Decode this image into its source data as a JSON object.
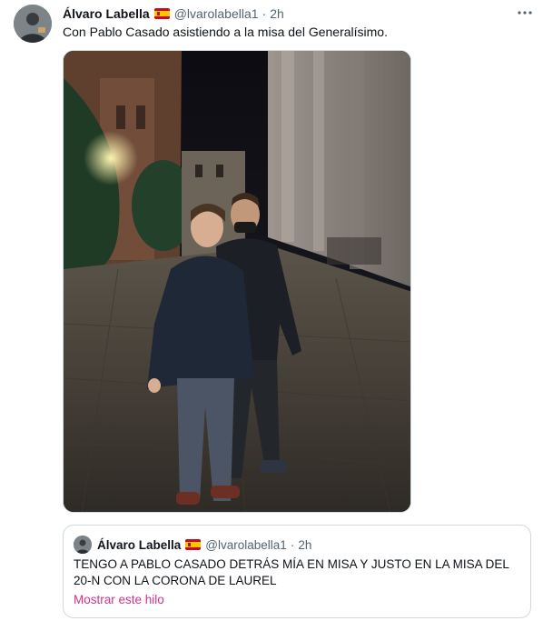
{
  "tweet": {
    "author_name": "Álvaro Labella",
    "flag_icon": "spain-flag-icon",
    "handle": "@lvarolabella1",
    "separator": "·",
    "time": "2h",
    "more_icon": "more-options-icon",
    "text": "Con Pablo Casado asistiendo a la misa del Generalísimo."
  },
  "quoted_tweet": {
    "author_name": "Álvaro Labella",
    "handle": "@lvarolabella1",
    "separator": "·",
    "time": "2h",
    "text": "TENGO A PABLO CASADO DETRÁS MÍA EN MISA Y JUSTO EN LA MISA DEL 20-N CON LA CORONA DE LAUREL",
    "show_thread_label": "Mostrar este hilo"
  },
  "colors": {
    "text": "#0f1419",
    "secondary": "#536471",
    "border": "#cfd9de",
    "link": "#d5318c"
  }
}
